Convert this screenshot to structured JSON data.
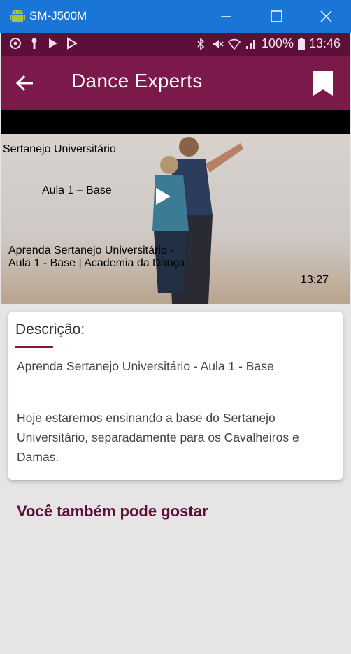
{
  "window": {
    "title": "SM-J500M"
  },
  "status_bar": {
    "battery": "100%",
    "time": "13:46"
  },
  "app_bar": {
    "title": "Dance Experts"
  },
  "video": {
    "overlay_tag_1": "Sertanejo Universitário",
    "overlay_tag_2": "Aula 1 – Base",
    "title_line_1": "Aprenda Sertanejo Universitário -",
    "title_line_2": "Aula 1 - Base | Academia da Dança",
    "duration": "13:27"
  },
  "description": {
    "heading": "Descrição:",
    "paragraph_1": "Aprenda Sertanejo Universitário - Aula 1 - Base",
    "paragraph_2": "Hoje estaremos ensinando a base do Sertanejo Universitário, separadamente para os Cavalheiros e Damas."
  },
  "related": {
    "heading": "Você também pode gostar"
  },
  "colors": {
    "window_bar": "#1976d6",
    "status_bar": "#5d0e39",
    "app_bar": "#7b1a4a",
    "play_button": "#e0217f",
    "accent_text": "#5d0e39",
    "background": "#e6e4e5"
  }
}
